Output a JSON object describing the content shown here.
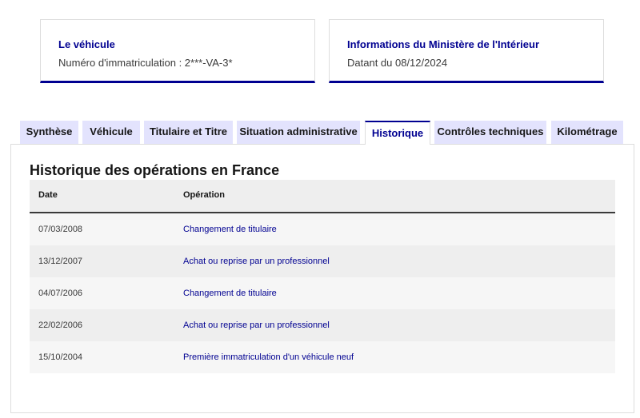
{
  "vehicle_card": {
    "title": "Le véhicule",
    "plate_text": "Numéro d'immatriculation : 2***-VA-3*"
  },
  "ministry_card": {
    "title": "Informations du Ministère de l'Intérieur",
    "date_text": "Datant du 08/12/2024"
  },
  "tabs": [
    {
      "label": "Synthèse"
    },
    {
      "label": "Véhicule"
    },
    {
      "label": "Titulaire et Titre"
    },
    {
      "label": "Situation administrative"
    },
    {
      "label": "Historique",
      "active": true
    },
    {
      "label": "Contrôles techniques"
    },
    {
      "label": "Kilométrage"
    }
  ],
  "panel": {
    "title": "Historique des opérations en France",
    "columns": {
      "date": "Date",
      "operation": "Opération"
    },
    "rows": [
      {
        "date": "07/03/2008",
        "operation": "Changement de titulaire"
      },
      {
        "date": "13/12/2007",
        "operation": "Achat ou reprise par un professionnel"
      },
      {
        "date": "04/07/2006",
        "operation": "Changement de titulaire"
      },
      {
        "date": "22/02/2006",
        "operation": "Achat ou reprise par un professionnel"
      },
      {
        "date": "15/10/2004",
        "operation": "Première immatriculation d'un véhicule neuf"
      }
    ]
  },
  "colors": {
    "accent": "#000091",
    "tab_bg": "#e3e3fd"
  }
}
